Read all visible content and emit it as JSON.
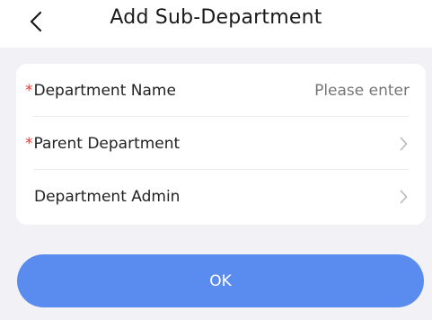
{
  "header": {
    "title": "Add Sub-Department",
    "back_icon": "chevron-left-icon"
  },
  "form": {
    "rows": [
      {
        "required_mark": "*",
        "label": "Department Name",
        "placeholder": "Please enter",
        "required": true
      },
      {
        "required_mark": "*",
        "label": "Parent Department",
        "icon": "chevron-right-icon",
        "required": true
      },
      {
        "label": "Department Admin",
        "icon": "chevron-right-icon",
        "required": false
      }
    ]
  },
  "ok_button": {
    "label": "OK"
  },
  "colors": {
    "background": "#f2f2f6",
    "card": "#ffffff",
    "required": "#e53935",
    "primary": "#5a8cf0",
    "placeholder": "#c2c2c6"
  }
}
